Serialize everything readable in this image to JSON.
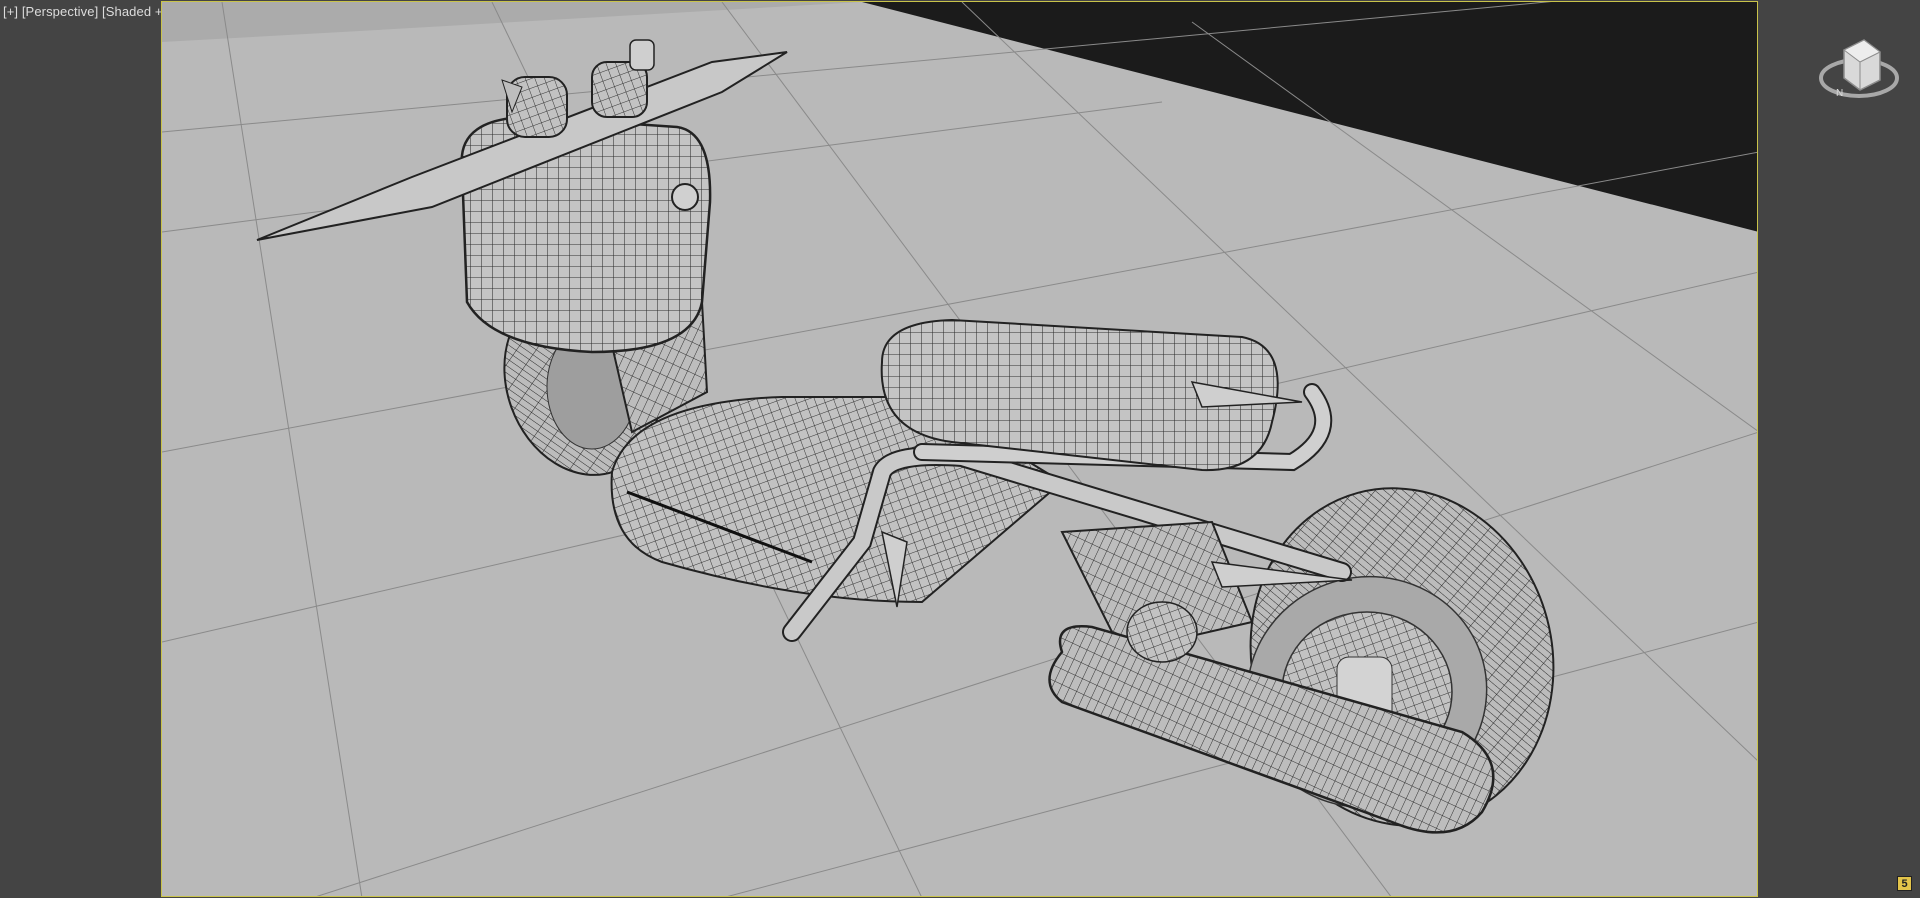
{
  "viewport": {
    "menu_label": "[+]",
    "view_label": "[Perspective]",
    "shading_label": "[Shaded + Edged Faces]"
  },
  "viewcube": {
    "icon": "viewcube-icon",
    "compass_label": "N"
  },
  "corner_badge": "5",
  "colors": {
    "background": "#444444",
    "ground": "#b9b9b9",
    "sky": "#1b1b1b",
    "model": "#c7c7c7",
    "wire": "#3a3a3a",
    "frame_border": "#c9c34a"
  }
}
